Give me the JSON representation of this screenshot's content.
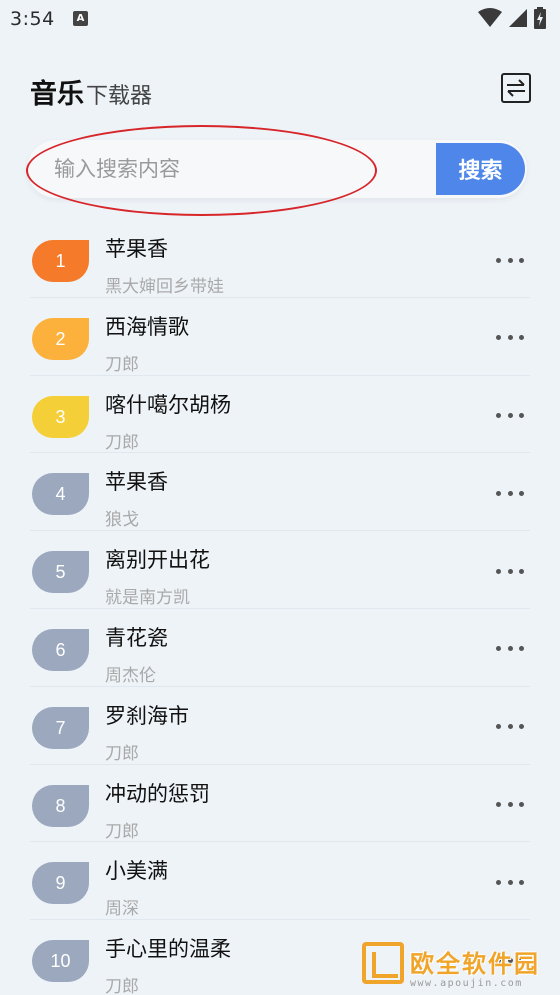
{
  "status_bar": {
    "time": "3:54",
    "notification_badge": "A"
  },
  "header": {
    "title_main": "音乐",
    "title_sub": "下载器"
  },
  "search": {
    "placeholder": "输入搜索内容",
    "value": "",
    "button_label": "搜索"
  },
  "colors": {
    "accent": "#4f86ea",
    "rank1": "#f57a2a",
    "rank2": "#fbb13c",
    "rank3": "#f5cf37",
    "rank_default": "#9ba8bd",
    "annotation": "#d7262a"
  },
  "songs": [
    {
      "rank": "1",
      "title": "苹果香",
      "artist": "黑大婶回乡带娃"
    },
    {
      "rank": "2",
      "title": "西海情歌",
      "artist": "刀郎"
    },
    {
      "rank": "3",
      "title": "喀什噶尔胡杨",
      "artist": "刀郎"
    },
    {
      "rank": "4",
      "title": "苹果香",
      "artist": "狼戈"
    },
    {
      "rank": "5",
      "title": "离别开出花",
      "artist": "就是南方凯"
    },
    {
      "rank": "6",
      "title": "青花瓷",
      "artist": "周杰伦"
    },
    {
      "rank": "7",
      "title": "罗刹海市",
      "artist": "刀郎"
    },
    {
      "rank": "8",
      "title": "冲动的惩罚",
      "artist": "刀郎"
    },
    {
      "rank": "9",
      "title": "小美满",
      "artist": "周深"
    },
    {
      "rank": "10",
      "title": "手心里的温柔",
      "artist": "刀郎"
    }
  ],
  "watermark": {
    "text": "欧全软件园",
    "url": "www.apoujin.com"
  }
}
